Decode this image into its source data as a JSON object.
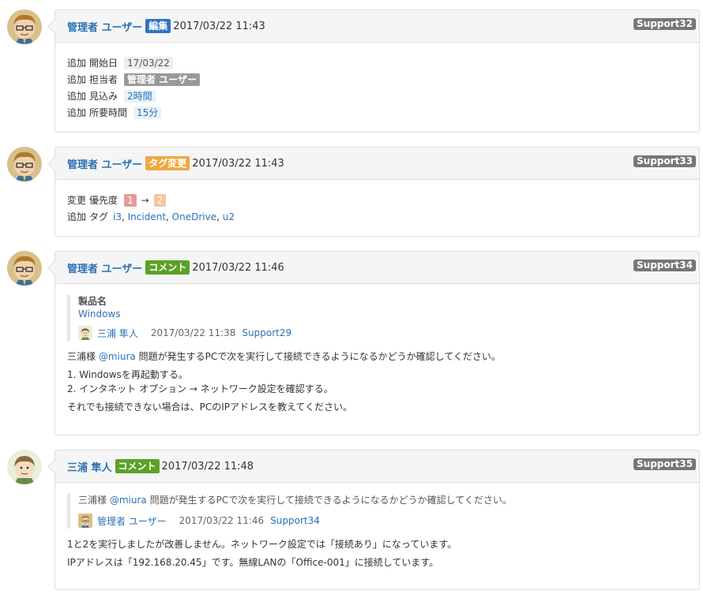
{
  "colors": {
    "link": "#2a72b5",
    "edit": "#2f74c0",
    "tag_change": "#efa841",
    "comment": "#5aa227",
    "ticket_badge": "#777777"
  },
  "entries": [
    {
      "author": "管理者 ユーザー",
      "kind": "編集",
      "time": "2017/03/22 11:43",
      "ticket": "Support32",
      "avatar": "admin-avatar",
      "rows": [
        {
          "action": "追加",
          "field": "開始日",
          "value": "17/03/22"
        },
        {
          "action": "追加",
          "field": "担当者",
          "value": "管理者 ユーザー"
        },
        {
          "action": "追加",
          "field": "見込み",
          "value": "2時間"
        },
        {
          "action": "追加",
          "field": "所要時間",
          "value": "15分"
        }
      ]
    },
    {
      "author": "管理者 ユーザー",
      "kind": "タグ変更",
      "time": "2017/03/22 11:43",
      "ticket": "Support33",
      "avatar": "admin-avatar",
      "priority": {
        "action": "変更",
        "field": "優先度",
        "from": "1",
        "arrow": "→",
        "to": "2"
      },
      "tags": {
        "action": "追加",
        "field": "タグ",
        "items": [
          "i3",
          "Incident",
          "OneDrive",
          "u2"
        ]
      }
    },
    {
      "author": "管理者 ユーザー",
      "kind": "コメント",
      "time": "2017/03/22 11:46",
      "ticket": "Support34",
      "avatar": "admin-avatar",
      "quote": {
        "title": "製品名",
        "value": "Windows",
        "who": "三浦 隼人",
        "when": "2017/03/22 11:38",
        "ref": "Support29"
      },
      "body": {
        "greeting": "三浦様",
        "mention": "@miura",
        "line1_rest": " 問題が発生するPCで次を実行して接続できるようになるかどうか確認してください。",
        "step1": "1. Windowsを再起動する。",
        "step2": "2. インタネット オプション → ネットワーク設定を確認する。",
        "closing": "それでも接続できない場合は、PCのIPアドレスを教えてください。"
      }
    },
    {
      "author": "三浦 隼人",
      "kind": "コメント",
      "time": "2017/03/22 11:48",
      "ticket": "Support35",
      "avatar": "miura-avatar",
      "quote": {
        "greeting": "三浦様",
        "mention": "@miura",
        "text_rest": " 問題が発生するPCで次を実行して接続できるようになるかどうか確認してください。",
        "who": "管理者 ユーザー",
        "when": "2017/03/22 11:46",
        "ref": "Support34"
      },
      "body": {
        "line1": "1と2を実行しましたが改善しません。ネットワーク設定では「接続あり」になっています。",
        "line2": "IPアドレスは「192.168.20.45」です。無線LANの「Office-001」に接続しています。"
      }
    }
  ]
}
